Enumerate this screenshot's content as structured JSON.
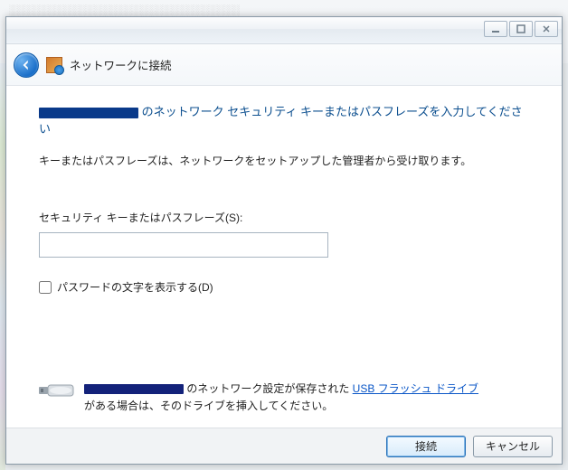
{
  "header": {
    "title": "ネットワークに接続"
  },
  "main": {
    "heading": " のネットワーク セキュリティ キーまたはパスフレーズを入力してください",
    "subtext": "キーまたはパスフレーズは、ネットワークをセットアップした管理者から受け取ります。",
    "field_label": "セキュリティ キーまたはパスフレーズ(S):",
    "field_value": "",
    "show_chars_label": "パスワードの文字を表示する(D)"
  },
  "usb": {
    "text_before": " のネットワーク設定が保存された ",
    "link": "USB フラッシュ ドライブ",
    "text_after": "がある場合は、そのドライブを挿入してください。"
  },
  "footer": {
    "connect": "接続",
    "cancel": "キャンセル"
  }
}
